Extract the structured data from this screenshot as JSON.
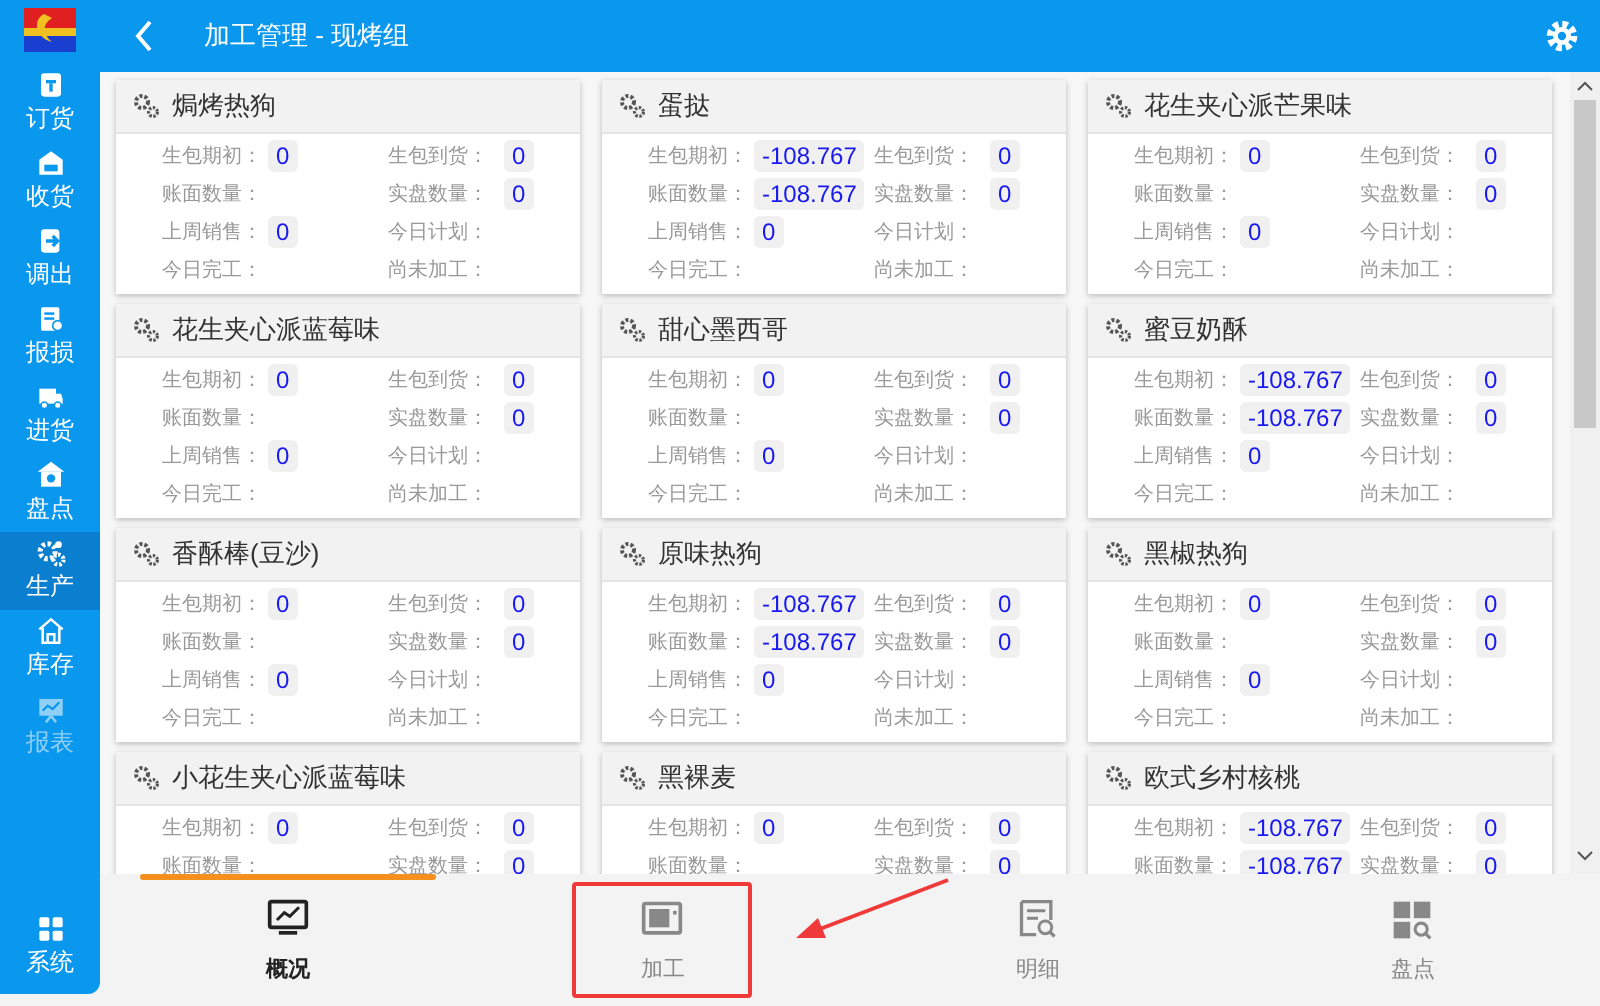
{
  "sidebar": {
    "items": [
      {
        "label": "订货",
        "kind": "order",
        "selected": false,
        "disabled": false
      },
      {
        "label": "收货",
        "kind": "receive",
        "selected": false,
        "disabled": false
      },
      {
        "label": "调出",
        "kind": "transfer",
        "selected": false,
        "disabled": false
      },
      {
        "label": "报损",
        "kind": "loss",
        "selected": false,
        "disabled": false
      },
      {
        "label": "进货",
        "kind": "truck",
        "selected": false,
        "disabled": false
      },
      {
        "label": "盘点",
        "kind": "stock",
        "selected": false,
        "disabled": false
      },
      {
        "label": "生产",
        "kind": "gears",
        "selected": true,
        "disabled": false
      },
      {
        "label": "库存",
        "kind": "house",
        "selected": false,
        "disabled": false
      },
      {
        "label": "报表",
        "kind": "chart",
        "selected": false,
        "disabled": true
      }
    ],
    "footer_item": {
      "label": "系统",
      "kind": "grid"
    }
  },
  "header": {
    "title": "加工管理 - 现烤组"
  },
  "cards": [
    {
      "name": "焗烤热狗",
      "fields": [
        {
          "label": "生包期初：",
          "value": "0"
        },
        {
          "label": "生包到货：",
          "value": "0"
        },
        {
          "label": "账面数量："
        },
        {
          "label": "实盘数量：",
          "value": "0"
        },
        {
          "label": "上周销售：",
          "value": "0"
        },
        {
          "label": "今日计划："
        },
        {
          "label": "今日完工："
        },
        {
          "label": "尚未加工："
        }
      ]
    },
    {
      "name": "蛋挞",
      "fields": [
        {
          "label": "生包期初：",
          "value": "-108.767"
        },
        {
          "label": "生包到货：",
          "value": "0"
        },
        {
          "label": "账面数量：",
          "value": "-108.767"
        },
        {
          "label": "实盘数量：",
          "value": "0"
        },
        {
          "label": "上周销售：",
          "value": "0"
        },
        {
          "label": "今日计划："
        },
        {
          "label": "今日完工："
        },
        {
          "label": "尚未加工："
        }
      ]
    },
    {
      "name": "花生夹心派芒果味",
      "fields": [
        {
          "label": "生包期初：",
          "value": "0"
        },
        {
          "label": "生包到货：",
          "value": "0"
        },
        {
          "label": "账面数量："
        },
        {
          "label": "实盘数量：",
          "value": "0"
        },
        {
          "label": "上周销售：",
          "value": "0"
        },
        {
          "label": "今日计划："
        },
        {
          "label": "今日完工："
        },
        {
          "label": "尚未加工："
        }
      ]
    },
    {
      "name": "花生夹心派蓝莓味",
      "fields": [
        {
          "label": "生包期初：",
          "value": "0"
        },
        {
          "label": "生包到货：",
          "value": "0"
        },
        {
          "label": "账面数量："
        },
        {
          "label": "实盘数量：",
          "value": "0"
        },
        {
          "label": "上周销售：",
          "value": "0"
        },
        {
          "label": "今日计划："
        },
        {
          "label": "今日完工："
        },
        {
          "label": "尚未加工："
        }
      ]
    },
    {
      "name": "甜心墨西哥",
      "fields": [
        {
          "label": "生包期初：",
          "value": "0"
        },
        {
          "label": "生包到货：",
          "value": "0"
        },
        {
          "label": "账面数量："
        },
        {
          "label": "实盘数量：",
          "value": "0"
        },
        {
          "label": "上周销售：",
          "value": "0"
        },
        {
          "label": "今日计划："
        },
        {
          "label": "今日完工："
        },
        {
          "label": "尚未加工："
        }
      ]
    },
    {
      "name": "蜜豆奶酥",
      "fields": [
        {
          "label": "生包期初：",
          "value": "-108.767"
        },
        {
          "label": "生包到货：",
          "value": "0"
        },
        {
          "label": "账面数量：",
          "value": "-108.767"
        },
        {
          "label": "实盘数量：",
          "value": "0"
        },
        {
          "label": "上周销售：",
          "value": "0"
        },
        {
          "label": "今日计划："
        },
        {
          "label": "今日完工："
        },
        {
          "label": "尚未加工："
        }
      ]
    },
    {
      "name": "香酥棒(豆沙)",
      "fields": [
        {
          "label": "生包期初：",
          "value": "0"
        },
        {
          "label": "生包到货：",
          "value": "0"
        },
        {
          "label": "账面数量："
        },
        {
          "label": "实盘数量：",
          "value": "0"
        },
        {
          "label": "上周销售：",
          "value": "0"
        },
        {
          "label": "今日计划："
        },
        {
          "label": "今日完工："
        },
        {
          "label": "尚未加工："
        }
      ]
    },
    {
      "name": "原味热狗",
      "fields": [
        {
          "label": "生包期初：",
          "value": "-108.767"
        },
        {
          "label": "生包到货：",
          "value": "0"
        },
        {
          "label": "账面数量：",
          "value": "-108.767"
        },
        {
          "label": "实盘数量：",
          "value": "0"
        },
        {
          "label": "上周销售：",
          "value": "0"
        },
        {
          "label": "今日计划："
        },
        {
          "label": "今日完工："
        },
        {
          "label": "尚未加工："
        }
      ]
    },
    {
      "name": "黑椒热狗",
      "fields": [
        {
          "label": "生包期初：",
          "value": "0"
        },
        {
          "label": "生包到货：",
          "value": "0"
        },
        {
          "label": "账面数量："
        },
        {
          "label": "实盘数量：",
          "value": "0"
        },
        {
          "label": "上周销售：",
          "value": "0"
        },
        {
          "label": "今日计划："
        },
        {
          "label": "今日完工："
        },
        {
          "label": "尚未加工："
        }
      ]
    },
    {
      "name": "小花生夹心派蓝莓味",
      "fields": [
        {
          "label": "生包期初：",
          "value": "0"
        },
        {
          "label": "生包到货：",
          "value": "0"
        },
        {
          "label": "账面数量："
        },
        {
          "label": "实盘数量：",
          "value": "0"
        }
      ]
    },
    {
      "name": "黑裸麦",
      "fields": [
        {
          "label": "生包期初：",
          "value": "0"
        },
        {
          "label": "生包到货：",
          "value": "0"
        },
        {
          "label": "账面数量："
        },
        {
          "label": "实盘数量：",
          "value": "0"
        }
      ]
    },
    {
      "name": "欧式乡村核桃",
      "fields": [
        {
          "label": "生包期初：",
          "value": "-108.767"
        },
        {
          "label": "生包到货：",
          "value": "0"
        },
        {
          "label": "账面数量：",
          "value": "-108.767"
        },
        {
          "label": "实盘数量：",
          "value": "0"
        }
      ]
    }
  ],
  "bottom_tabs": [
    {
      "label": "概况",
      "kind": "monitor",
      "selected": true,
      "highlighted": false
    },
    {
      "label": "加工",
      "kind": "oven",
      "selected": false,
      "highlighted": true
    },
    {
      "label": "明细",
      "kind": "doc",
      "selected": false,
      "highlighted": false
    },
    {
      "label": "盘点",
      "kind": "tiles",
      "selected": false,
      "highlighted": false
    }
  ]
}
